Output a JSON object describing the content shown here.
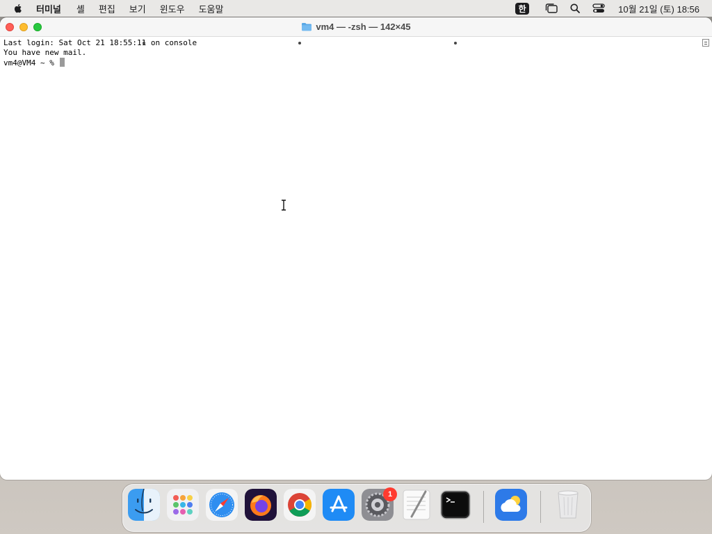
{
  "menubar": {
    "app_name": "터미널",
    "items": [
      "셸",
      "편집",
      "보기",
      "윈도우",
      "도움말"
    ],
    "input_source": "한",
    "clock": "10월 21일 (토) 18:56"
  },
  "window": {
    "title": "vm4 — -zsh — 142×45",
    "lines": [
      "Last login: Sat Oct 21 18:55:11 on console",
      "You have new mail.",
      "vm4@VM4 ~ % "
    ]
  },
  "dock": {
    "apps": [
      {
        "name": "Finder",
        "running": true
      },
      {
        "name": "Launchpad",
        "running": false
      },
      {
        "name": "Safari",
        "running": false
      },
      {
        "name": "Firefox",
        "running": false
      },
      {
        "name": "Chrome",
        "running": true
      },
      {
        "name": "App Store",
        "running": false
      },
      {
        "name": "System Settings",
        "running": false,
        "badge": "1"
      },
      {
        "name": "TextEdit",
        "running": false
      },
      {
        "name": "Terminal",
        "running": true
      },
      {
        "name": "Weather",
        "running": false
      },
      {
        "name": "Trash",
        "running": false
      }
    ]
  },
  "colors": {
    "close": "#ff5f57",
    "minimize": "#febc2e",
    "maximize": "#28c840",
    "badge": "#ff3b30"
  }
}
